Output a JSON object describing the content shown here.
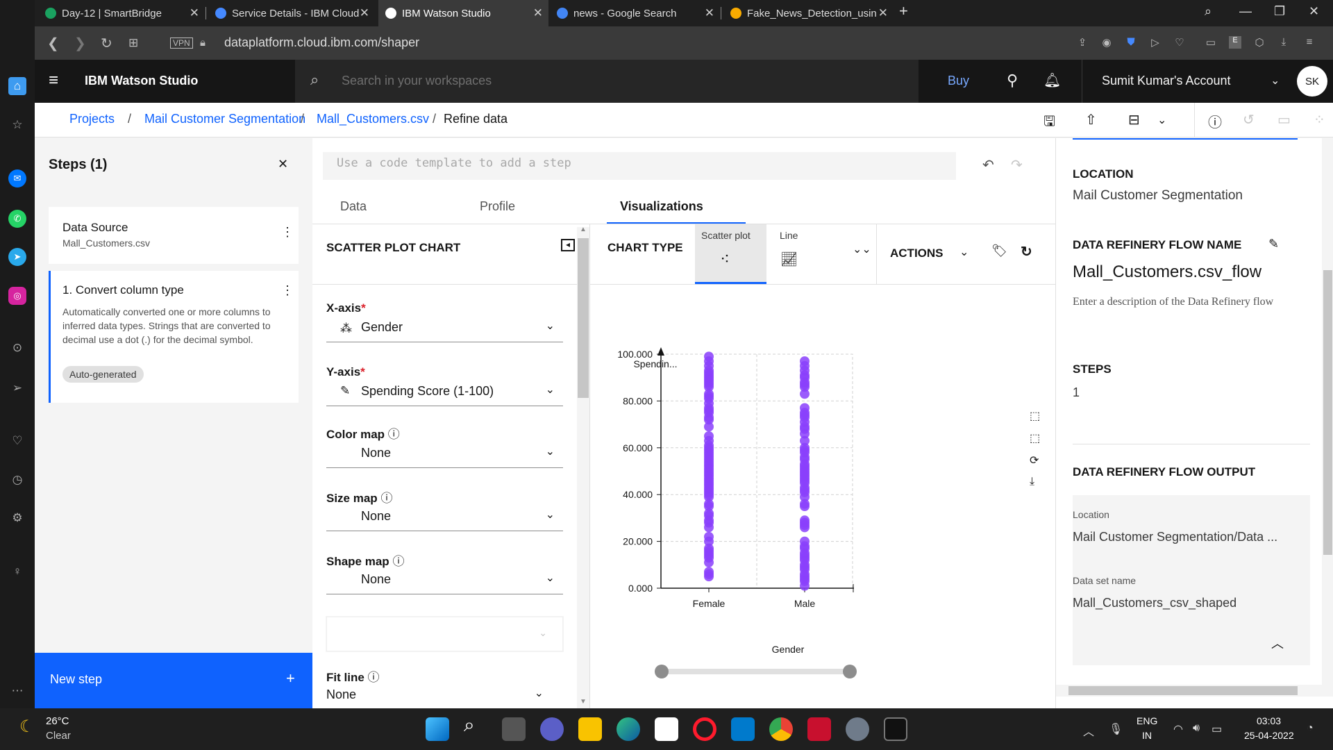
{
  "browser": {
    "tabs": [
      {
        "title": "Day-12 | SmartBridge",
        "color": "#1aa260"
      },
      {
        "title": "Service Details - IBM Cloud",
        "color": "#4589ff"
      },
      {
        "title": "IBM Watson Studio",
        "color": "#ffffff"
      },
      {
        "title": "news - Google Search",
        "color": "#4285f4"
      },
      {
        "title": "Fake_News_Detection_usin",
        "color": "#f9ab00"
      }
    ],
    "vpn": "VPN",
    "url": "dataplatform.cloud.ibm.com/shaper"
  },
  "header": {
    "brand": "IBM Watson Studio",
    "search_placeholder": "Search in your workspaces",
    "buy": "Buy",
    "account": "Sumit Kumar's Account",
    "avatar": "SK"
  },
  "breadcrumb": {
    "items": [
      "Projects",
      "Mail Customer Segmentation",
      "Mall_Customers.csv"
    ],
    "current": "Refine data",
    "sep": "/"
  },
  "steps": {
    "title": "Steps (1)",
    "source_title": "Data Source",
    "source_file": "Mall_Customers.csv",
    "step1_title": "1. Convert column type",
    "step1_desc": "Automatically converted one or more columns to inferred data types. Strings that are converted to decimal use a dot (.) for the decimal symbol.",
    "step1_tag": "Auto-generated",
    "new_step": "New step",
    "plus": "+"
  },
  "editor": {
    "template_placeholder": "Use a code template to add a step",
    "tabs": [
      "Data",
      "Profile",
      "Visualizations"
    ],
    "active_tab": "Visualizations"
  },
  "chart_settings": {
    "title": "SCATTER PLOT CHART",
    "x_label": "X-axis",
    "x_value": "Gender",
    "y_label": "Y-axis",
    "y_value": "Spending Score (1-100)",
    "color_label": "Color map",
    "color_value": "None",
    "size_label": "Size map",
    "size_value": "None",
    "shape_label": "Shape map",
    "shape_value": "None",
    "fit_label": "Fit line",
    "fit_value": "None",
    "required": "*"
  },
  "chart_toolbar": {
    "chart_type": "CHART TYPE",
    "scatter": "Scatter plot",
    "line": "Line",
    "actions": "ACTIONS"
  },
  "chart_data": {
    "type": "scatter",
    "title": "",
    "xlabel": "Gender",
    "ylabel": "Spendin...",
    "categories": [
      "Female",
      "Male"
    ],
    "ylim": [
      0,
      100
    ],
    "yticks": [
      "0.000",
      "20.000",
      "40.000",
      "60.000",
      "80.000",
      "100.000"
    ],
    "grid": true,
    "marker_color": "#8a3ffc",
    "series": [
      {
        "category": "Female",
        "values": [
          5,
          6,
          7,
          11,
          13,
          14,
          15,
          16,
          17,
          20,
          22,
          26,
          28,
          29,
          31,
          32,
          35,
          36,
          39,
          40,
          41,
          42,
          43,
          44,
          45,
          46,
          47,
          48,
          49,
          50,
          51,
          52,
          53,
          54,
          55,
          56,
          57,
          58,
          59,
          60,
          61,
          63,
          65,
          69,
          72,
          73,
          75,
          76,
          77,
          79,
          81,
          82,
          83,
          86,
          87,
          88,
          89,
          90,
          91,
          92,
          93,
          95,
          97,
          99
        ]
      },
      {
        "category": "Male",
        "values": [
          1,
          3,
          4,
          5,
          6,
          8,
          9,
          10,
          12,
          13,
          14,
          15,
          17,
          18,
          20,
          26,
          27,
          28,
          29,
          35,
          36,
          39,
          41,
          42,
          43,
          45,
          46,
          47,
          48,
          49,
          50,
          51,
          52,
          53,
          55,
          56,
          58,
          59,
          60,
          63,
          66,
          68,
          69,
          71,
          73,
          74,
          75,
          77,
          83,
          86,
          87,
          88,
          90,
          91,
          93,
          95,
          97
        ]
      }
    ]
  },
  "properties": {
    "location_label": "LOCATION",
    "location_value": "Mail Customer Segmentation",
    "flow_name_label": "DATA REFINERY FLOW NAME",
    "flow_name_value": "Mall_Customers.csv_flow",
    "description_placeholder": "Enter a description of the Data Refinery flow",
    "steps_label": "STEPS",
    "steps_value": "1",
    "output_label": "DATA REFINERY FLOW OUTPUT",
    "out_location_label": "Location",
    "out_location_value": "Mail Customer Segmentation/Data ...",
    "dataset_label": "Data set name",
    "dataset_value": "Mall_Customers_csv_shaped"
  },
  "taskbar": {
    "temp": "26°C",
    "weather": "Clear",
    "lang1": "ENG",
    "lang2": "IN",
    "time": "03:03",
    "date": "25-04-2022"
  }
}
